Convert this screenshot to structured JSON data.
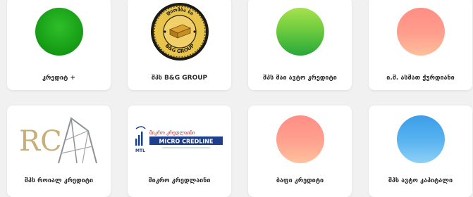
{
  "colors": {
    "page_background": "#f1f1f1",
    "card_background": "#ffffff",
    "label_text": "#2a2a2a"
  },
  "cards": [
    {
      "label": "კრედიტ +",
      "icon": "green-circle-logo"
    },
    {
      "label": "შპს B&G GROUP",
      "icon": "bg-group-gold-seal-logo",
      "logo_text": {
        "top": "დიომბა ბი",
        "bottom": "B&G GROUP"
      }
    },
    {
      "label": "შპს მაი ავტო კრედიტი",
      "icon": "lime-green-circle-logo"
    },
    {
      "label": "ი.მ. ასმათ ქურდიანი",
      "icon": "salmon-circle-logo"
    },
    {
      "label": "შპს როიალ კრედიტი",
      "icon": "royal-credit-rc-logo",
      "logo_text": {
        "letters": "RC"
      }
    },
    {
      "label": "მიკრო კრედლაინი",
      "icon": "micro-credline-logo",
      "logo_text": {
        "georgian": "მიკრო კრედლაინი",
        "english": "MICRO CREDLINE",
        "mark": "MTL"
      }
    },
    {
      "label": "ბაფი კრედიტი",
      "icon": "salmon-circle-logo"
    },
    {
      "label": "შპს ავტო კაპიტალი",
      "icon": "blue-circle-logo"
    }
  ]
}
